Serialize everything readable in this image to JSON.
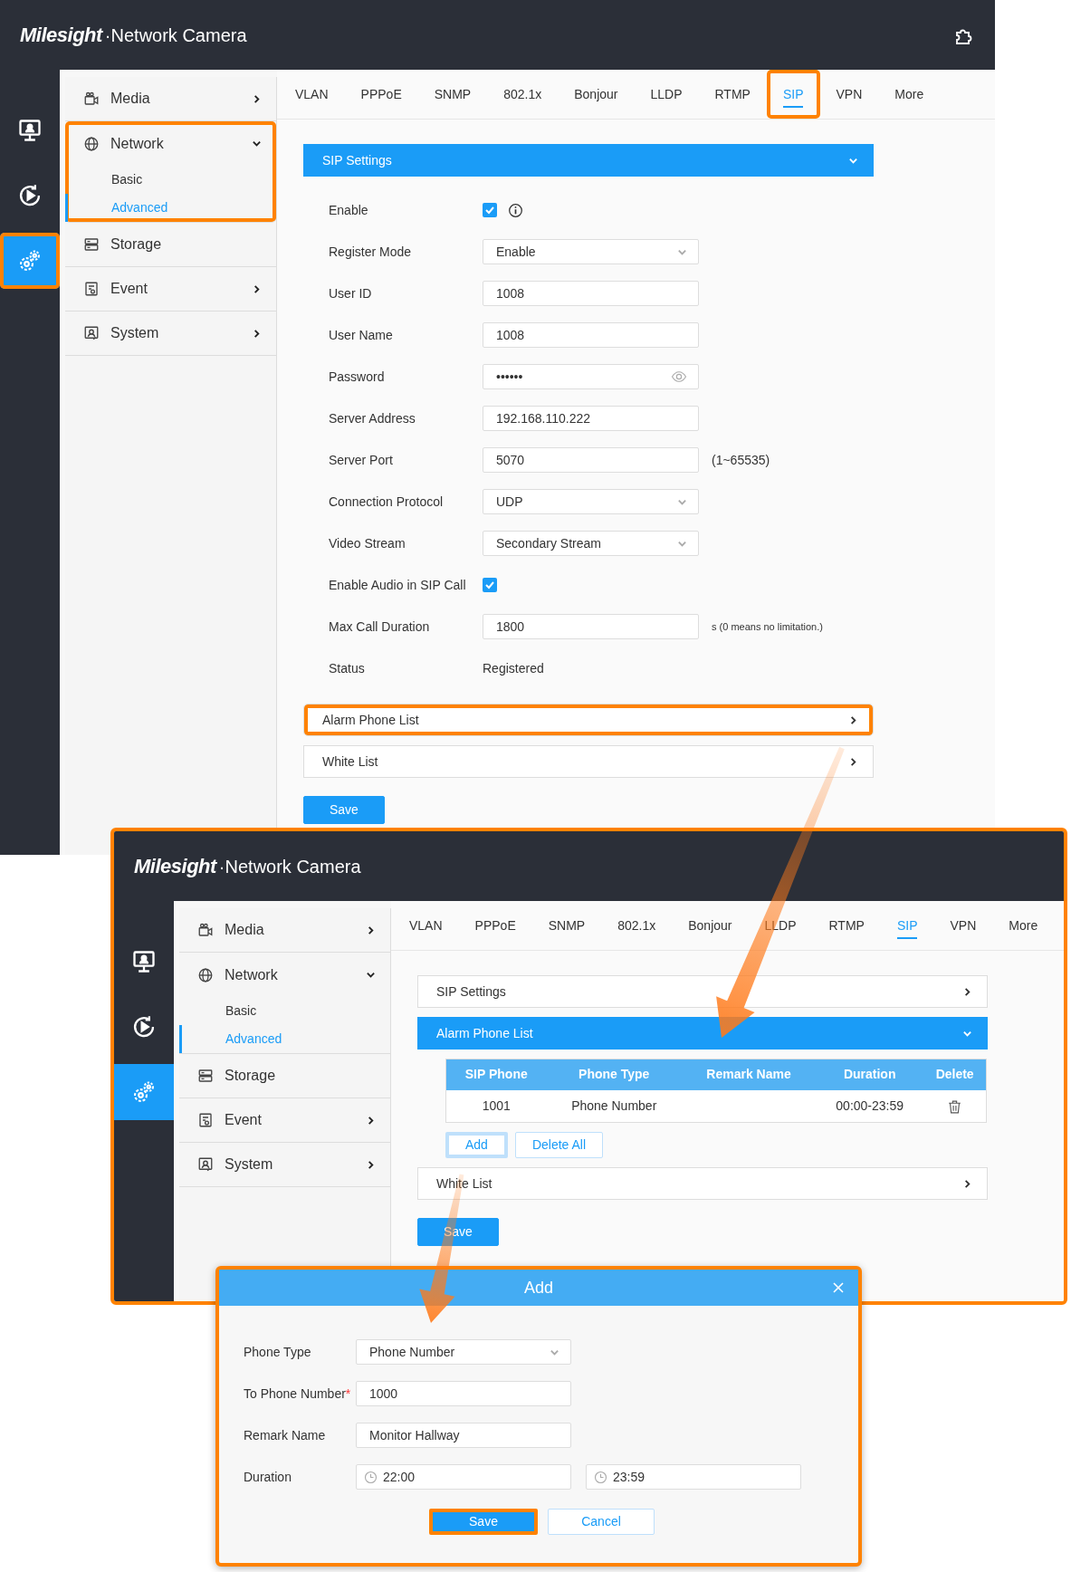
{
  "screens": [
    {
      "header": {
        "brand": "Milesight",
        "title": "·Network Camera",
        "plugin_icon": true
      },
      "rail": [
        {
          "kind": "live",
          "selected": false,
          "highlighted": false
        },
        {
          "kind": "playback",
          "selected": false,
          "highlighted": false
        },
        {
          "kind": "settings",
          "selected": true,
          "highlighted": true
        }
      ],
      "sidebar": [
        {
          "kind": "media",
          "label": "Media",
          "expandable": true,
          "expanded": false,
          "highlighted": false
        },
        {
          "kind": "network",
          "label": "Network",
          "expandable": true,
          "expanded": true,
          "highlighted": true,
          "children": [
            {
              "label": "Basic",
              "selected": false
            },
            {
              "label": "Advanced",
              "selected": true
            }
          ]
        },
        {
          "kind": "storage",
          "label": "Storage",
          "expandable": false,
          "highlighted": false
        },
        {
          "kind": "event",
          "label": "Event",
          "expandable": true,
          "expanded": false,
          "highlighted": false
        },
        {
          "kind": "system",
          "label": "System",
          "expandable": true,
          "expanded": false,
          "highlighted": false
        }
      ],
      "tabs": [
        {
          "label": "VLAN",
          "selected": false,
          "highlighted": false
        },
        {
          "label": "PPPoE",
          "selected": false,
          "highlighted": false
        },
        {
          "label": "SNMP",
          "selected": false,
          "highlighted": false
        },
        {
          "label": "802.1x",
          "selected": false,
          "highlighted": false
        },
        {
          "label": "Bonjour",
          "selected": false,
          "highlighted": false
        },
        {
          "label": "LLDP",
          "selected": false,
          "highlighted": false
        },
        {
          "label": "RTMP",
          "selected": false,
          "highlighted": false
        },
        {
          "label": "SIP",
          "selected": true,
          "highlighted": true
        },
        {
          "label": "VPN",
          "selected": false,
          "highlighted": false
        },
        {
          "label": "More",
          "selected": false,
          "highlighted": false
        }
      ],
      "sections": [
        {
          "title": "SIP Settings",
          "expanded": true,
          "highlighted": false,
          "fields": [
            {
              "kind": "checkbox",
              "label": "Enable",
              "checked": true,
              "info": true
            },
            {
              "kind": "select",
              "label": "Register Mode",
              "value": "Enable"
            },
            {
              "kind": "text",
              "label": "User ID",
              "value": "1008"
            },
            {
              "kind": "text",
              "label": "User Name",
              "value": "1008"
            },
            {
              "kind": "password",
              "label": "Password",
              "value": "••••••"
            },
            {
              "kind": "text",
              "label": "Server Address",
              "value": "192.168.110.222"
            },
            {
              "kind": "text",
              "label": "Server Port",
              "value": "5070",
              "note": "(1~65535)"
            },
            {
              "kind": "select",
              "label": "Connection Protocol",
              "value": "UDP"
            },
            {
              "kind": "select",
              "label": "Video Stream",
              "value": "Secondary Stream"
            },
            {
              "kind": "checkbox",
              "label": "Enable Audio in SIP Call",
              "checked": true,
              "info": false
            },
            {
              "kind": "text",
              "label": "Max Call Duration",
              "value": "1800",
              "note": "s (0 means no limitation.)"
            },
            {
              "kind": "static",
              "label": "Status",
              "value": "Registered"
            }
          ]
        },
        {
          "title": "Alarm Phone List",
          "expanded": false,
          "highlighted": true
        },
        {
          "title": "White List",
          "expanded": false,
          "highlighted": false
        }
      ],
      "save": {
        "label": "Save",
        "highlighted": false
      }
    },
    {
      "header": {
        "brand": "Milesight",
        "title": "·Network Camera"
      },
      "rail": [
        {
          "kind": "live",
          "selected": false,
          "highlighted": false
        },
        {
          "kind": "playback",
          "selected": false,
          "highlighted": false
        },
        {
          "kind": "settings",
          "selected": true,
          "highlighted": false
        }
      ],
      "sidebar": [
        {
          "kind": "media",
          "label": "Media",
          "expandable": true,
          "expanded": false,
          "highlighted": false
        },
        {
          "kind": "network",
          "label": "Network",
          "expandable": true,
          "expanded": true,
          "highlighted": false,
          "children": [
            {
              "label": "Basic",
              "selected": false
            },
            {
              "label": "Advanced",
              "selected": true
            }
          ]
        },
        {
          "kind": "storage",
          "label": "Storage",
          "expandable": false,
          "highlighted": false
        },
        {
          "kind": "event",
          "label": "Event",
          "expandable": true,
          "expanded": false,
          "highlighted": false
        },
        {
          "kind": "system",
          "label": "System",
          "expandable": true,
          "expanded": false,
          "highlighted": false
        }
      ],
      "tabs": [
        {
          "label": "VLAN",
          "selected": false,
          "highlighted": false
        },
        {
          "label": "PPPoE",
          "selected": false,
          "highlighted": false
        },
        {
          "label": "SNMP",
          "selected": false,
          "highlighted": false
        },
        {
          "label": "802.1x",
          "selected": false,
          "highlighted": false
        },
        {
          "label": "Bonjour",
          "selected": false,
          "highlighted": false
        },
        {
          "label": "LLDP",
          "selected": false,
          "highlighted": false
        },
        {
          "label": "RTMP",
          "selected": false,
          "highlighted": false
        },
        {
          "label": "SIP",
          "selected": true,
          "highlighted": false
        },
        {
          "label": "VPN",
          "selected": false,
          "highlighted": false
        },
        {
          "label": "More",
          "selected": false,
          "highlighted": false
        }
      ],
      "sections": [
        {
          "title": "SIP Settings",
          "expanded": false,
          "highlighted": false
        },
        {
          "title": "Alarm Phone List",
          "expanded": true,
          "highlighted": false,
          "table": {
            "columns": [
              "SIP Phone",
              "Phone Type",
              "Remark Name",
              "Duration",
              "Delete"
            ],
            "rows": [
              {
                "cells": [
                  "1001",
                  "Phone Number",
                  "",
                  "00:00-23:59"
                ],
                "deletable": true
              }
            ]
          },
          "buttons": [
            {
              "kind": "secondary",
              "label": "Add",
              "highlighted": true
            },
            {
              "kind": "secondary",
              "label": "Delete All",
              "highlighted": false
            }
          ]
        },
        {
          "title": "White List",
          "expanded": false,
          "highlighted": false
        }
      ],
      "save": {
        "label": "Save",
        "highlighted": false
      }
    }
  ],
  "dialog": {
    "title": "Add",
    "fields": [
      {
        "kind": "select",
        "label": "Phone Type",
        "value": "Phone Number"
      },
      {
        "kind": "text",
        "label": "To Phone Number",
        "required_mark": "*",
        "value": "1000"
      },
      {
        "kind": "text",
        "label": "Remark Name",
        "value": "Monitor Hallway"
      },
      {
        "kind": "time_range",
        "label": "Duration",
        "values": [
          "22:00",
          "23:59"
        ]
      }
    ],
    "buttons": [
      {
        "kind": "primary",
        "label": "Save",
        "highlighted": true
      },
      {
        "kind": "secondary",
        "label": "Cancel",
        "highlighted": false
      }
    ]
  }
}
